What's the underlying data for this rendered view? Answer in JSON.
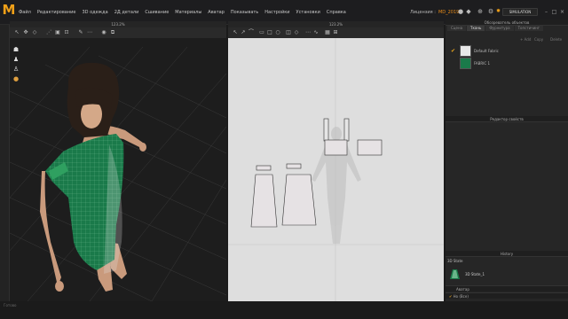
{
  "app": {
    "logo": "M"
  },
  "menu": [
    "Файл",
    "Редактирование",
    "3D одежда",
    "2Д детали",
    "Сшивание",
    "Материалы",
    "Аватар",
    "Показывать",
    "Настройки",
    "Установки",
    "Справка"
  ],
  "user": {
    "prefix": "Лицензия :",
    "name": "MD_2019"
  },
  "simulation_label": "SIMULATION",
  "viewport3d": {
    "title": "123.2%"
  },
  "viewport2d": {
    "title": "123.2%"
  },
  "right_panel": {
    "object_browser_title": "Обозреватель объектов",
    "tabs": [
      "Сцена",
      "Ткань",
      "Фурнитура",
      "Топстичинг"
    ],
    "tab_active": "Ткань",
    "actions": [
      "+ Add",
      "Copy",
      "Delete"
    ],
    "fabrics": [
      {
        "name": "Default Fabric",
        "color": "#e8e8e8",
        "checked": true
      },
      {
        "name": "FABRIC 1",
        "color": "#1a7a4a",
        "checked": false
      }
    ],
    "property_title": "Редактор свойств",
    "history_title": "History",
    "history_section": "3D State",
    "history_item": "3D State_1",
    "rows": [
      "Аватар",
      "Но (Все)"
    ]
  },
  "status": {
    "text": "Готово"
  },
  "colors": {
    "accent": "#f0a018",
    "dress": "#1a7a4a",
    "canvas2d": "#dedede"
  }
}
